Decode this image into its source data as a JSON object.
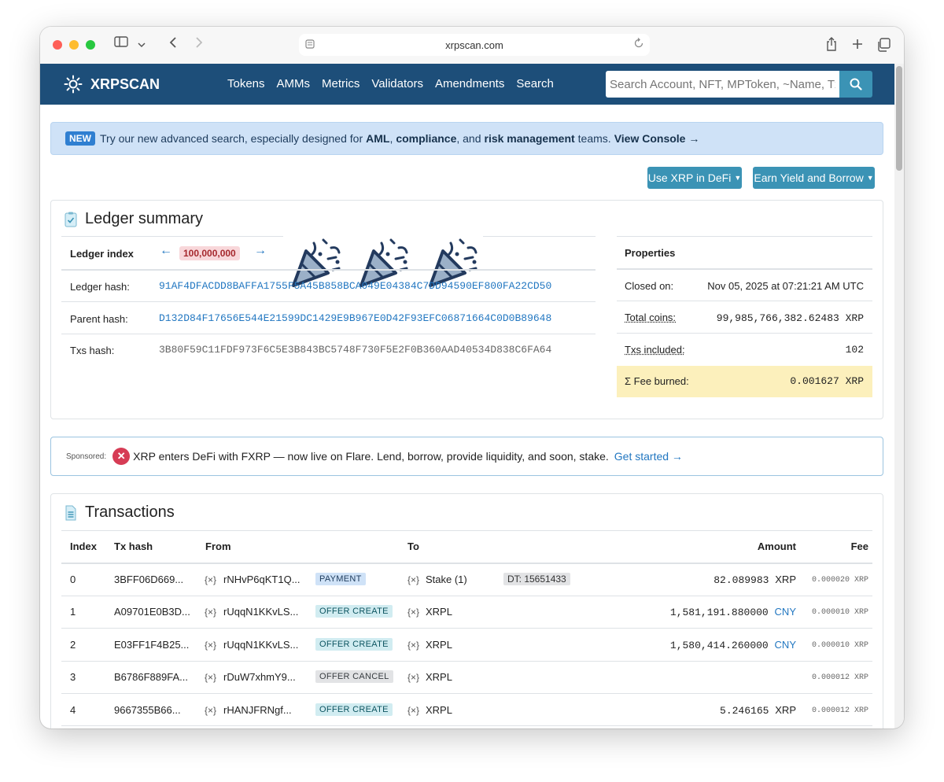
{
  "browser": {
    "url": "xrpscan.com"
  },
  "navbar": {
    "brand": "XRPSCAN",
    "links": [
      "Tokens",
      "AMMs",
      "Metrics",
      "Validators",
      "Amendments",
      "Search"
    ],
    "search_placeholder": "Search Account, NFT, MPToken, ~Name, Tx"
  },
  "banner": {
    "badge": "NEW",
    "text1": "Try our new advanced search, especially designed for",
    "bold1": "AML",
    "comma": ",",
    "bold2": "compliance",
    "text2": ", and",
    "bold3": "risk management",
    "text3": "teams.",
    "cta": "View Console →"
  },
  "defi_buttons": {
    "use_xrp": "Use XRP in DeFi",
    "earn_yield": "Earn Yield and Borrow"
  },
  "ledger_summary": {
    "title": "Ledger summary",
    "index_label": "Ledger index",
    "index_value": "100,000,000",
    "prev_arrow": "←",
    "next_arrow": "→",
    "ledger_hash_label": "Ledger hash:",
    "ledger_hash": "91AF4DFACDD8BAFFA1755F5A45B858BCA049E04384C7DD94590EF800FA22CD50",
    "parent_hash_label": "Parent hash:",
    "parent_hash": "D132D84F17656E544E21599DC1429E9B967E0D42F93EFC06871664C0D0B89648",
    "txs_hash_label": "Txs hash:",
    "txs_hash": "3B80F59C11FDF973F6C5E3B843BC5748F730F5E2F0B360AAD40534D838C6FA64",
    "properties_label": "Properties",
    "closed_on_label": "Closed on:",
    "closed_on": "Nov 05, 2025 at 07:21:21 AM UTC",
    "total_coins_label": "Total coins:",
    "total_coins": "99,985,766,382.62483 XRP",
    "txs_included_label": "Txs included:",
    "txs_included": "102",
    "fee_burned_label": "Σ Fee burned:",
    "fee_burned": "0.001627 XRP"
  },
  "sponsored": {
    "label": "Sponsored:",
    "text": "XRP enters DeFi with FXRP — now live on Flare. Lend, borrow, provide liquidity, and soon, stake.",
    "link": "Get started →"
  },
  "transactions": {
    "title": "Transactions",
    "headers": {
      "index": "Index",
      "tx_hash": "Tx hash",
      "from": "From",
      "to": "To",
      "amount": "Amount",
      "fee": "Fee"
    },
    "account_icon": "{×}",
    "rows": [
      {
        "index": "0",
        "hash": "3BFF06D669...",
        "from": "rNHvP6qKT1Q...",
        "type": "PAYMENT",
        "to": "Stake (1)",
        "dt": "DT: 15651433",
        "amount": "82.089983",
        "currency": "XRP",
        "fee": "0.000020 XRP"
      },
      {
        "index": "1",
        "hash": "A09701E0B3D...",
        "from": "rUqqN1KKvLS...",
        "type": "OFFER CREATE",
        "to": "XRPL",
        "dt": "",
        "amount": "1,581,191.880000",
        "currency": "CNY",
        "fee": "0.000010 XRP"
      },
      {
        "index": "2",
        "hash": "E03FF1F4B25...",
        "from": "rUqqN1KKvLS...",
        "type": "OFFER CREATE",
        "to": "XRPL",
        "dt": "",
        "amount": "1,580,414.260000",
        "currency": "CNY",
        "fee": "0.000010 XRP"
      },
      {
        "index": "3",
        "hash": "B6786F889FA...",
        "from": "rDuW7xhmY9...",
        "type": "OFFER CANCEL",
        "to": "XRPL",
        "dt": "",
        "amount": "",
        "currency": "",
        "fee": "0.000012 XRP"
      },
      {
        "index": "4",
        "hash": "9667355B66...",
        "from": "rHANJFRNgf...",
        "type": "OFFER CREATE",
        "to": "XRPL",
        "dt": "",
        "amount": "5.246165",
        "currency": "XRP",
        "fee": "0.000012 XRP"
      }
    ]
  }
}
